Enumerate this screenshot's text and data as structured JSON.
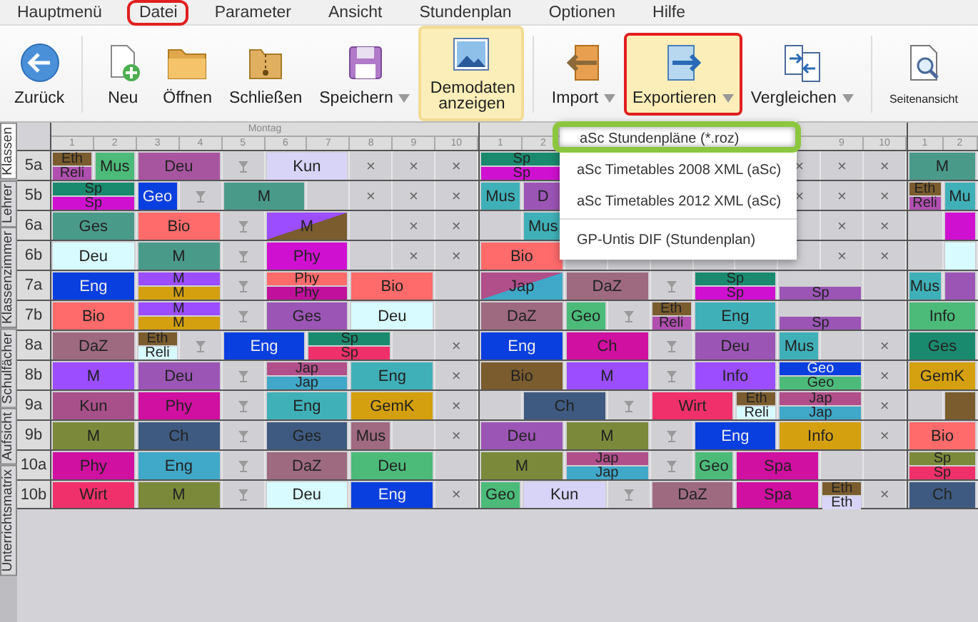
{
  "menu": [
    {
      "label": "Hauptmenü",
      "selected": false
    },
    {
      "label": "Datei",
      "selected": true
    },
    {
      "label": "Parameter",
      "selected": false
    },
    {
      "label": "Ansicht",
      "selected": false
    },
    {
      "label": "Stundenplan",
      "selected": false
    },
    {
      "label": "Optionen",
      "selected": false
    },
    {
      "label": "Hilfe",
      "selected": false
    }
  ],
  "toolbar_groups": [
    [
      {
        "kind": "back",
        "label": "Zurück",
        "dropdown": false,
        "active": false
      }
    ],
    [
      {
        "kind": "new",
        "label": "Neu",
        "dropdown": false,
        "active": false
      },
      {
        "kind": "open",
        "label": "Öffnen",
        "dropdown": false,
        "active": false
      },
      {
        "kind": "close",
        "label": "Schließen",
        "dropdown": false,
        "active": false
      },
      {
        "kind": "save",
        "label": "Speichern",
        "dropdown": true,
        "active": false
      },
      {
        "kind": "demo",
        "label": "Demodaten anzeigen",
        "dropdown": false,
        "active": true
      }
    ],
    [
      {
        "kind": "import",
        "label": "Import",
        "dropdown": true,
        "active": false
      },
      {
        "kind": "export",
        "label": "Exportieren",
        "dropdown": true,
        "active": true
      },
      {
        "kind": "compare",
        "label": "Vergleichen",
        "dropdown": true,
        "active": false
      }
    ],
    [
      {
        "kind": "preview",
        "label": "Seitenansicht",
        "dropdown": false,
        "active": false
      }
    ]
  ],
  "side_tabs": [
    {
      "label": "Klassen",
      "selected": true
    },
    {
      "label": "Lehrer",
      "selected": false
    },
    {
      "label": "Klassenzimmer",
      "selected": false
    },
    {
      "label": "Schulfächer",
      "selected": false
    },
    {
      "label": "Aufsicht",
      "selected": false
    },
    {
      "label": "Unterrichtsmatrix",
      "selected": false
    }
  ],
  "classes": [
    "5a",
    "5b",
    "6a",
    "6b",
    "7a",
    "7b",
    "8a",
    "8b",
    "9a",
    "9b",
    "10a",
    "10b"
  ],
  "days": [
    {
      "name": "Montag",
      "periods": [
        "1",
        "2",
        "3",
        "4",
        "5",
        "6",
        "7",
        "8",
        "9",
        "10"
      ],
      "rows": [
        {
          "cells": [
            {
              "kind": "lesson",
              "parts": [
                {
                  "label": "Eth",
                  "color": "#7a5c2e"
                },
                {
                  "label": "Reli",
                  "color": "#b04fb0"
                }
              ]
            },
            {
              "kind": "lesson",
              "parts": [
                {
                  "label": "Mus",
                  "color": "#4cbb7a"
                }
              ]
            },
            {
              "kind": "lesson",
              "parts": [
                {
                  "label": "Deu",
                  "color": "#a855a0"
                }
              ]
            },
            {
              "kind": "continued"
            },
            {
              "kind": "lunch"
            },
            {
              "kind": "lesson",
              "parts": [
                {
                  "label": "Kun",
                  "color": "#d8d4f8"
                }
              ]
            },
            {
              "kind": "continued"
            },
            {
              "kind": "blocked",
              "mark": "×"
            },
            {
              "kind": "blocked",
              "mark": "×"
            },
            {
              "kind": "blocked",
              "mark": "×"
            }
          ]
        },
        {
          "cells": [
            {
              "kind": "lesson",
              "parts": [
                {
                  "label": "Sp",
                  "color": "#1a8a6e"
                },
                {
                  "label": "Sp",
                  "color": "#d010d0"
                }
              ]
            },
            {
              "kind": "continued"
            },
            {
              "kind": "lesson",
              "parts": [
                {
                  "label": "Geo",
                  "color": "#0a3fdf"
                }
              ]
            },
            {
              "kind": "lunch"
            },
            {
              "kind": "lesson",
              "parts": [
                {
                  "label": "M",
                  "color": "#4a9a8a"
                }
              ]
            },
            {
              "kind": "continued"
            },
            {
              "kind": "empty"
            },
            {
              "kind": "blocked",
              "mark": "×"
            },
            {
              "kind": "blocked",
              "mark": "×"
            },
            {
              "kind": "blocked",
              "mark": "×"
            }
          ]
        },
        {
          "cells": [
            {
              "kind": "lesson",
              "parts": [
                {
                  "label": "Ges",
                  "color": "#4a9a8a"
                }
              ]
            },
            {
              "kind": "continued"
            },
            {
              "kind": "lesson",
              "parts": [
                {
                  "label": "Bio",
                  "color": "#ff6b6b"
                }
              ]
            },
            {
              "kind": "continued"
            },
            {
              "kind": "lunch"
            },
            {
              "kind": "lesson",
              "diagonal": true,
              "parts": [
                {
                  "label": "M",
                  "color": "#9b4dff"
                },
                {
                  "color": "#7a5c2e"
                }
              ]
            },
            {
              "kind": "continued"
            },
            {
              "kind": "empty"
            },
            {
              "kind": "blocked",
              "mark": "×"
            },
            {
              "kind": "blocked",
              "mark": "×"
            }
          ]
        },
        {
          "cells": [
            {
              "kind": "lesson",
              "parts": [
                {
                  "label": "Deu",
                  "color": "#d8fbff"
                }
              ]
            },
            {
              "kind": "continued"
            },
            {
              "kind": "lesson",
              "parts": [
                {
                  "label": "M",
                  "color": "#4a9a8a"
                }
              ]
            },
            {
              "kind": "continued"
            },
            {
              "kind": "lunch"
            },
            {
              "kind": "lesson",
              "parts": [
                {
                  "label": "Phy",
                  "color": "#d010d0"
                }
              ]
            },
            {
              "kind": "continued"
            },
            {
              "kind": "empty"
            },
            {
              "kind": "blocked",
              "mark": "×"
            },
            {
              "kind": "blocked",
              "mark": "×"
            }
          ]
        },
        {
          "cells": [
            {
              "kind": "lesson",
              "parts": [
                {
                  "label": "Eng",
                  "color": "#0a3fdf"
                }
              ]
            },
            {
              "kind": "continued"
            },
            {
              "kind": "lesson",
              "parts": [
                {
                  "label": "M",
                  "color": "#9b4dff"
                },
                {
                  "label": "M",
                  "color": "#d4a010"
                }
              ]
            },
            {
              "kind": "continued"
            },
            {
              "kind": "lunch"
            },
            {
              "kind": "lesson",
              "parts": [
                {
                  "label": "Phy",
                  "color": "#ff6b6b"
                },
                {
                  "label": "Phy",
                  "color": "#c0109c"
                }
              ]
            },
            {
              "kind": "continued"
            },
            {
              "kind": "lesson",
              "parts": [
                {
                  "label": "Bio",
                  "color": "#ff6b6b"
                }
              ]
            },
            {
              "kind": "continued"
            },
            {
              "kind": "empty"
            }
          ]
        },
        {
          "cells": [
            {
              "kind": "lesson",
              "parts": [
                {
                  "label": "Bio",
                  "color": "#ff6b6b"
                }
              ]
            },
            {
              "kind": "continued"
            },
            {
              "kind": "lesson",
              "parts": [
                {
                  "label": "M",
                  "color": "#9b4dff"
                },
                {
                  "label": "M",
                  "color": "#d4a010"
                }
              ]
            },
            {
              "kind": "continued"
            },
            {
              "kind": "lunch"
            },
            {
              "kind": "lesson",
              "parts": [
                {
                  "label": "Ges",
                  "color": "#9b55b5"
                }
              ]
            },
            {
              "kind": "continued"
            },
            {
              "kind": "lesson",
              "parts": [
                {
                  "label": "Deu",
                  "color": "#d8fbff"
                }
              ]
            },
            {
              "kind": "continued"
            },
            {
              "kind": "empty"
            }
          ]
        },
        {
          "cells": [
            {
              "kind": "lesson",
              "parts": [
                {
                  "label": "DaZ",
                  "color": "#9e6a80"
                }
              ]
            },
            {
              "kind": "continued"
            },
            {
              "kind": "lesson",
              "parts": [
                {
                  "label": "Eth",
                  "color": "#7a5c2e"
                },
                {
                  "label": "Reli",
                  "color": "#d8fbff"
                }
              ]
            },
            {
              "kind": "lunch"
            },
            {
              "kind": "lesson",
              "parts": [
                {
                  "label": "Eng",
                  "color": "#0a3fdf"
                }
              ]
            },
            {
              "kind": "continued"
            },
            {
              "kind": "lesson",
              "parts": [
                {
                  "label": "Sp",
                  "color": "#1a8a6e"
                },
                {
                  "label": "Sp",
                  "color": "#f0306a"
                }
              ]
            },
            {
              "kind": "continued"
            },
            {
              "kind": "empty"
            },
            {
              "kind": "blocked",
              "mark": "×"
            }
          ]
        },
        {
          "cells": [
            {
              "kind": "lesson",
              "parts": [
                {
                  "label": "M",
                  "color": "#9b4dff"
                }
              ]
            },
            {
              "kind": "continued"
            },
            {
              "kind": "lesson",
              "parts": [
                {
                  "label": "Deu",
                  "color": "#9b55b5"
                }
              ]
            },
            {
              "kind": "continued"
            },
            {
              "kind": "lunch"
            },
            {
              "kind": "lesson",
              "parts": [
                {
                  "label": "Jap",
                  "color": "#b04f8a"
                },
                {
                  "label": "Jap",
                  "color": "#40a8c8"
                }
              ]
            },
            {
              "kind": "continued"
            },
            {
              "kind": "lesson",
              "parts": [
                {
                  "label": "Eng",
                  "color": "#40b0b8"
                }
              ]
            },
            {
              "kind": "continued"
            },
            {
              "kind": "blocked",
              "mark": "×"
            }
          ]
        },
        {
          "cells": [
            {
              "kind": "lesson",
              "parts": [
                {
                  "label": "Kun",
                  "color": "#a8508a"
                }
              ]
            },
            {
              "kind": "continued"
            },
            {
              "kind": "lesson",
              "parts": [
                {
                  "label": "Phy",
                  "color": "#d010a0"
                }
              ]
            },
            {
              "kind": "continued"
            },
            {
              "kind": "lunch"
            },
            {
              "kind": "lesson",
              "parts": [
                {
                  "label": "Eng",
                  "color": "#40b0b8"
                }
              ]
            },
            {
              "kind": "continued"
            },
            {
              "kind": "lesson",
              "parts": [
                {
                  "label": "GemK",
                  "color": "#d4a010"
                }
              ]
            },
            {
              "kind": "continued"
            },
            {
              "kind": "blocked",
              "mark": "×"
            }
          ]
        },
        {
          "cells": [
            {
              "kind": "lesson",
              "parts": [
                {
                  "label": "M",
                  "color": "#7a8a3a"
                }
              ]
            },
            {
              "kind": "continued"
            },
            {
              "kind": "lesson",
              "parts": [
                {
                  "label": "Ch",
                  "color": "#3e5a80"
                }
              ]
            },
            {
              "kind": "continued"
            },
            {
              "kind": "lunch"
            },
            {
              "kind": "lesson",
              "parts": [
                {
                  "label": "Ges",
                  "color": "#3e5a80"
                }
              ]
            },
            {
              "kind": "continued"
            },
            {
              "kind": "lesson",
              "parts": [
                {
                  "label": "Mus",
                  "color": "#a06a80"
                }
              ]
            },
            {
              "kind": "empty"
            },
            {
              "kind": "blocked",
              "mark": "×"
            }
          ]
        },
        {
          "cells": [
            {
              "kind": "lesson",
              "parts": [
                {
                  "label": "Phy",
                  "color": "#d010a0"
                }
              ]
            },
            {
              "kind": "continued"
            },
            {
              "kind": "lesson",
              "parts": [
                {
                  "label": "Eng",
                  "color": "#40a8c8"
                }
              ]
            },
            {
              "kind": "continued"
            },
            {
              "kind": "lunch"
            },
            {
              "kind": "lesson",
              "parts": [
                {
                  "label": "DaZ",
                  "color": "#9e6a80"
                }
              ]
            },
            {
              "kind": "continued"
            },
            {
              "kind": "lesson",
              "parts": [
                {
                  "label": "Deu",
                  "color": "#4cbb7a"
                }
              ]
            },
            {
              "kind": "continued"
            },
            {
              "kind": "empty"
            }
          ]
        },
        {
          "cells": [
            {
              "kind": "lesson",
              "parts": [
                {
                  "label": "Wirt",
                  "color": "#f0306a"
                }
              ]
            },
            {
              "kind": "continued"
            },
            {
              "kind": "lesson",
              "parts": [
                {
                  "label": "M",
                  "color": "#7a8a3a"
                }
              ]
            },
            {
              "kind": "continued"
            },
            {
              "kind": "lunch"
            },
            {
              "kind": "lesson",
              "parts": [
                {
                  "label": "Deu",
                  "color": "#d8fbff"
                }
              ]
            },
            {
              "kind": "continued"
            },
            {
              "kind": "lesson",
              "parts": [
                {
                  "label": "Eng",
                  "color": "#0a3fdf"
                }
              ]
            },
            {
              "kind": "continued"
            },
            {
              "kind": "blocked",
              "mark": "×"
            }
          ]
        }
      ]
    },
    {
      "periods": [
        "1",
        "2"
      ],
      "periods_after_menu": [
        "9",
        "10"
      ],
      "rows": [
        {
          "cells": [
            {
              "kind": "lesson",
              "parts": [
                {
                  "label": "Sp",
                  "color": "#1a8a6e"
                },
                {
                  "label": "Sp",
                  "color": "#d010d0"
                }
              ]
            },
            {
              "kind": "continued"
            },
            {
              "kind": "empty"
            },
            {
              "kind": "empty"
            },
            {
              "kind": "empty"
            },
            {
              "kind": "empty"
            },
            {
              "kind": "empty"
            },
            {
              "kind": "blocked",
              "mark": "×"
            },
            {
              "kind": "blocked",
              "mark": "×"
            },
            {
              "kind": "blocked",
              "mark": "×"
            }
          ]
        },
        {
          "cells": [
            {
              "kind": "lesson",
              "parts": [
                {
                  "label": "Mus",
                  "color": "#40b0b8"
                }
              ]
            },
            {
              "kind": "lesson",
              "parts": [
                {
                  "label": "D",
                  "color": "#9b55b5"
                }
              ]
            },
            {
              "kind": "empty"
            },
            {
              "kind": "empty"
            },
            {
              "kind": "empty"
            },
            {
              "kind": "empty"
            },
            {
              "kind": "empty"
            },
            {
              "kind": "blocked",
              "mark": "×"
            },
            {
              "kind": "blocked",
              "mark": "×"
            },
            {
              "kind": "blocked",
              "mark": "×"
            }
          ]
        },
        {
          "cells": [
            {
              "kind": "empty"
            },
            {
              "kind": "lesson",
              "parts": [
                {
                  "label": "Mus",
                  "color": "#40b0b8"
                }
              ]
            },
            {
              "kind": "empty"
            },
            {
              "kind": "empty"
            },
            {
              "kind": "empty"
            },
            {
              "kind": "empty"
            },
            {
              "kind": "empty"
            },
            {
              "kind": "empty"
            },
            {
              "kind": "blocked",
              "mark": "×"
            },
            {
              "kind": "blocked",
              "mark": "×"
            }
          ]
        },
        {
          "cells": [
            {
              "kind": "lesson",
              "parts": [
                {
                  "label": "Bio",
                  "color": "#ff6b6b"
                }
              ]
            },
            {
              "kind": "continued"
            },
            {
              "kind": "empty"
            },
            {
              "kind": "empty"
            },
            {
              "kind": "empty"
            },
            {
              "kind": "empty"
            },
            {
              "kind": "empty"
            },
            {
              "kind": "empty"
            },
            {
              "kind": "blocked",
              "mark": "×"
            },
            {
              "kind": "blocked",
              "mark": "×"
            }
          ]
        },
        {
          "cells": [
            {
              "kind": "lesson",
              "diagonal": true,
              "parts": [
                {
                  "label": "Jap",
                  "color": "#b04f8a"
                },
                {
                  "color": "#40a8c8"
                }
              ]
            },
            {
              "kind": "continued"
            },
            {
              "kind": "lesson",
              "parts": [
                {
                  "label": "DaZ",
                  "color": "#9e6a80"
                }
              ]
            },
            {
              "kind": "continued"
            },
            {
              "kind": "lunch"
            },
            {
              "kind": "lesson",
              "parts": [
                {
                  "label": "Sp",
                  "color": "#1a8a6e"
                },
                {
                  "label": "Sp",
                  "color": "#d010d0"
                }
              ]
            },
            {
              "kind": "continued"
            },
            {
              "kind": "lesson",
              "lower_only": true,
              "parts": [
                {
                  "label": "Sp",
                  "color": "#9b55b5"
                }
              ]
            },
            {
              "kind": "continued"
            },
            {
              "kind": "empty"
            }
          ]
        },
        {
          "cells": [
            {
              "kind": "lesson",
              "parts": [
                {
                  "label": "DaZ",
                  "color": "#9e6a80"
                }
              ]
            },
            {
              "kind": "continued"
            },
            {
              "kind": "lesson",
              "parts": [
                {
                  "label": "Geo",
                  "color": "#4cbb7a"
                }
              ]
            },
            {
              "kind": "lunch"
            },
            {
              "kind": "lesson",
              "parts": [
                {
                  "label": "Eth",
                  "color": "#7a5c2e"
                },
                {
                  "label": "Reli",
                  "color": "#b04fb0"
                }
              ]
            },
            {
              "kind": "lesson",
              "parts": [
                {
                  "label": "Eng",
                  "color": "#40b0b8"
                }
              ]
            },
            {
              "kind": "continued"
            },
            {
              "kind": "lesson",
              "lower_only": true,
              "parts": [
                {
                  "label": "Sp",
                  "color": "#9b55b5"
                }
              ]
            },
            {
              "kind": "continued"
            },
            {
              "kind": "empty"
            }
          ]
        },
        {
          "cells": [
            {
              "kind": "lesson",
              "parts": [
                {
                  "label": "Eng",
                  "color": "#0a3fdf"
                }
              ]
            },
            {
              "kind": "continued"
            },
            {
              "kind": "lesson",
              "parts": [
                {
                  "label": "Ch",
                  "color": "#d010a0"
                }
              ]
            },
            {
              "kind": "continued"
            },
            {
              "kind": "lunch"
            },
            {
              "kind": "lesson",
              "parts": [
                {
                  "label": "Deu",
                  "color": "#9b55b5"
                }
              ]
            },
            {
              "kind": "continued"
            },
            {
              "kind": "lesson",
              "parts": [
                {
                  "label": "Mus",
                  "color": "#40b0b8"
                }
              ]
            },
            {
              "kind": "empty"
            },
            {
              "kind": "blocked",
              "mark": "×"
            }
          ]
        },
        {
          "cells": [
            {
              "kind": "lesson",
              "parts": [
                {
                  "label": "Bio",
                  "color": "#7a5c2e"
                }
              ]
            },
            {
              "kind": "continued"
            },
            {
              "kind": "lesson",
              "parts": [
                {
                  "label": "M",
                  "color": "#9b4dff"
                }
              ]
            },
            {
              "kind": "continued"
            },
            {
              "kind": "lunch"
            },
            {
              "kind": "lesson",
              "parts": [
                {
                  "label": "Info",
                  "color": "#9b4dff"
                }
              ]
            },
            {
              "kind": "continued"
            },
            {
              "kind": "lesson",
              "parts": [
                {
                  "label": "Geo",
                  "color": "#0a3fdf"
                },
                {
                  "label": "Geo",
                  "color": "#4cbb7a"
                }
              ]
            },
            {
              "kind": "continued"
            },
            {
              "kind": "blocked",
              "mark": "×"
            }
          ]
        },
        {
          "cells": [
            {
              "kind": "empty"
            },
            {
              "kind": "lesson",
              "parts": [
                {
                  "label": "Ch",
                  "color": "#3e5a80"
                }
              ]
            },
            {
              "kind": "continued"
            },
            {
              "kind": "lunch"
            },
            {
              "kind": "lesson",
              "parts": [
                {
                  "label": "Wirt",
                  "color": "#f0306a"
                }
              ]
            },
            {
              "kind": "continued"
            },
            {
              "kind": "lesson",
              "parts": [
                {
                  "label": "Eth",
                  "color": "#7a5c2e"
                },
                {
                  "label": "Reli",
                  "color": "#d8fbff"
                }
              ]
            },
            {
              "kind": "lesson",
              "parts": [
                {
                  "label": "Jap",
                  "color": "#b04f8a"
                },
                {
                  "label": "Jap",
                  "color": "#40a8c8"
                }
              ]
            },
            {
              "kind": "continued"
            },
            {
              "kind": "blocked",
              "mark": "×"
            }
          ]
        },
        {
          "cells": [
            {
              "kind": "lesson",
              "parts": [
                {
                  "label": "Deu",
                  "color": "#9b55b5"
                }
              ]
            },
            {
              "kind": "continued"
            },
            {
              "kind": "lesson",
              "parts": [
                {
                  "label": "M",
                  "color": "#7a8a3a"
                }
              ]
            },
            {
              "kind": "continued"
            },
            {
              "kind": "lunch"
            },
            {
              "kind": "lesson",
              "parts": [
                {
                  "label": "Eng",
                  "color": "#0a3fdf"
                }
              ]
            },
            {
              "kind": "continued"
            },
            {
              "kind": "lesson",
              "parts": [
                {
                  "label": "Info",
                  "color": "#d4a010"
                }
              ]
            },
            {
              "kind": "continued"
            },
            {
              "kind": "blocked",
              "mark": "×"
            }
          ]
        },
        {
          "cells": [
            {
              "kind": "lesson",
              "parts": [
                {
                  "label": "M",
                  "color": "#7a8a3a"
                }
              ]
            },
            {
              "kind": "continued"
            },
            {
              "kind": "lesson",
              "parts": [
                {
                  "label": "Jap",
                  "color": "#b04f8a"
                },
                {
                  "label": "Jap",
                  "color": "#40a8c8"
                }
              ]
            },
            {
              "kind": "continued"
            },
            {
              "kind": "lunch"
            },
            {
              "kind": "lesson",
              "parts": [
                {
                  "label": "Geo",
                  "color": "#4cbb7a"
                }
              ]
            },
            {
              "kind": "lesson",
              "parts": [
                {
                  "label": "Spa",
                  "color": "#d010a0"
                }
              ]
            },
            {
              "kind": "continued"
            },
            {
              "kind": "empty"
            },
            {
              "kind": "empty"
            }
          ]
        },
        {
          "cells": [
            {
              "kind": "lesson",
              "parts": [
                {
                  "label": "Geo",
                  "color": "#4cbb7a"
                }
              ]
            },
            {
              "kind": "lesson",
              "parts": [
                {
                  "label": "Kun",
                  "color": "#d8d4f8"
                }
              ]
            },
            {
              "kind": "continued"
            },
            {
              "kind": "lunch"
            },
            {
              "kind": "lesson",
              "parts": [
                {
                  "label": "DaZ",
                  "color": "#9e6a80"
                }
              ]
            },
            {
              "kind": "continued"
            },
            {
              "kind": "lesson",
              "parts": [
                {
                  "label": "Spa",
                  "color": "#d010a0"
                }
              ]
            },
            {
              "kind": "continued"
            },
            {
              "kind": "lesson",
              "parts": [
                {
                  "label": "Eth",
                  "color": "#7a5c2e"
                },
                {
                  "label": "Eth",
                  "color": "#d8d4f8"
                }
              ]
            },
            {
              "kind": "blocked",
              "mark": "×"
            }
          ]
        }
      ]
    },
    {
      "periods": [
        "1",
        "2"
      ],
      "rows": [
        {
          "cells": [
            {
              "kind": "lesson",
              "parts": [
                {
                  "label": "M",
                  "color": "#4a9a8a"
                }
              ]
            },
            {
              "kind": "continued"
            }
          ]
        },
        {
          "cells": [
            {
              "kind": "lesson",
              "parts": [
                {
                  "label": "Eth",
                  "color": "#7a5c2e"
                },
                {
                  "label": "Reli",
                  "color": "#b04fb0"
                }
              ]
            },
            {
              "kind": "lesson",
              "parts": [
                {
                  "label": "Mu",
                  "color": "#40b0b8"
                }
              ]
            }
          ]
        },
        {
          "cells": [
            {
              "kind": "empty"
            },
            {
              "kind": "lesson",
              "parts": [
                {
                  "color": "#d010d0"
                }
              ]
            }
          ]
        },
        {
          "cells": [
            {
              "kind": "empty"
            },
            {
              "kind": "lesson",
              "parts": [
                {
                  "color": "#d8fbff"
                }
              ]
            }
          ]
        },
        {
          "cells": [
            {
              "kind": "lesson",
              "parts": [
                {
                  "label": "Mus",
                  "color": "#40b0b8"
                }
              ]
            },
            {
              "kind": "lesson",
              "parts": [
                {
                  "color": "#9b55b5"
                }
              ]
            }
          ]
        },
        {
          "cells": [
            {
              "kind": "lesson",
              "parts": [
                {
                  "label": "Info",
                  "color": "#4cbb7a"
                }
              ]
            },
            {
              "kind": "continued"
            }
          ]
        },
        {
          "cells": [
            {
              "kind": "lesson",
              "parts": [
                {
                  "label": "Ges",
                  "color": "#1a8a6e"
                }
              ]
            },
            {
              "kind": "continued"
            }
          ]
        },
        {
          "cells": [
            {
              "kind": "lesson",
              "parts": [
                {
                  "label": "GemK",
                  "color": "#d4a010"
                }
              ]
            },
            {
              "kind": "continued"
            }
          ]
        },
        {
          "cells": [
            {
              "kind": "empty"
            },
            {
              "kind": "lesson",
              "parts": [
                {
                  "color": "#7a5c2e"
                }
              ]
            }
          ]
        },
        {
          "cells": [
            {
              "kind": "lesson",
              "parts": [
                {
                  "label": "Bio",
                  "color": "#ff6b6b"
                }
              ]
            },
            {
              "kind": "continued"
            }
          ]
        },
        {
          "cells": [
            {
              "kind": "lesson",
              "parts": [
                {
                  "label": "Sp",
                  "color": "#7a8a3a"
                },
                {
                  "label": "Sp",
                  "color": "#f0306a"
                }
              ]
            },
            {
              "kind": "continued"
            }
          ]
        },
        {
          "cells": [
            {
              "kind": "lesson",
              "parts": [
                {
                  "label": "Ch",
                  "color": "#3e5a80"
                }
              ]
            },
            {
              "kind": "continued"
            }
          ]
        }
      ]
    }
  ],
  "export_menu": [
    {
      "label": "aSc Stundenpläne (*.roz)",
      "selected": true,
      "separator_before": false
    },
    {
      "label": "aSc Timetables 2008 XML (aSc)",
      "selected": false,
      "separator_before": false
    },
    {
      "label": "aSc Timetables 2012 XML (aSc)",
      "selected": false,
      "separator_before": false
    },
    {
      "label": "GP-Untis DIF (Stundenplan)",
      "selected": false,
      "separator_before": true
    }
  ]
}
